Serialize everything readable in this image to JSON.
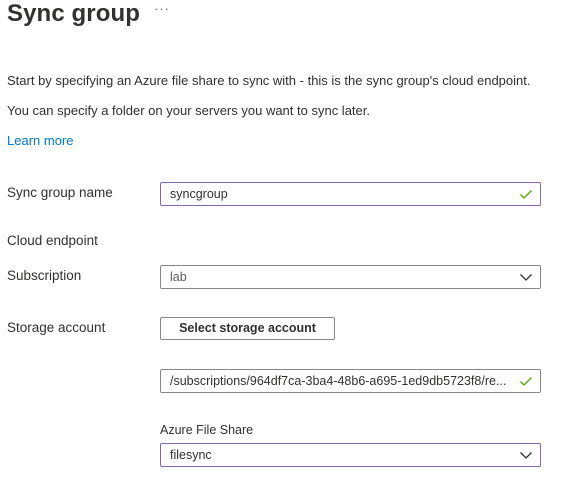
{
  "header": {
    "title": "Sync group",
    "more_label": "···"
  },
  "intro": {
    "line1": "Start by specifying an Azure file share to sync with - this is the sync group's cloud endpoint.",
    "line2": "You can specify a folder on your servers you want to sync later.",
    "learn_more": "Learn more"
  },
  "form": {
    "sync_group_name": {
      "label": "Sync group name",
      "value": "syncgroup"
    },
    "cloud_endpoint_heading": "Cloud endpoint",
    "subscription": {
      "label": "Subscription",
      "value": "lab"
    },
    "storage_account": {
      "label": "Storage account",
      "button_label": "Select storage account",
      "resource_path": "/subscriptions/964df7ca-3ba4-48b6-a695-1ed9db5723f8/re..."
    },
    "azure_file_share": {
      "label": "Azure File Share",
      "value": "filesync"
    }
  },
  "icons": {
    "valid": "checkmark-icon",
    "dropdown": "chevron-down-icon"
  },
  "colors": {
    "accent_link": "#0078d4",
    "valid_check": "#57a300",
    "focus_border": "#8764b8",
    "border": "#8a8886",
    "text": "#323130"
  }
}
